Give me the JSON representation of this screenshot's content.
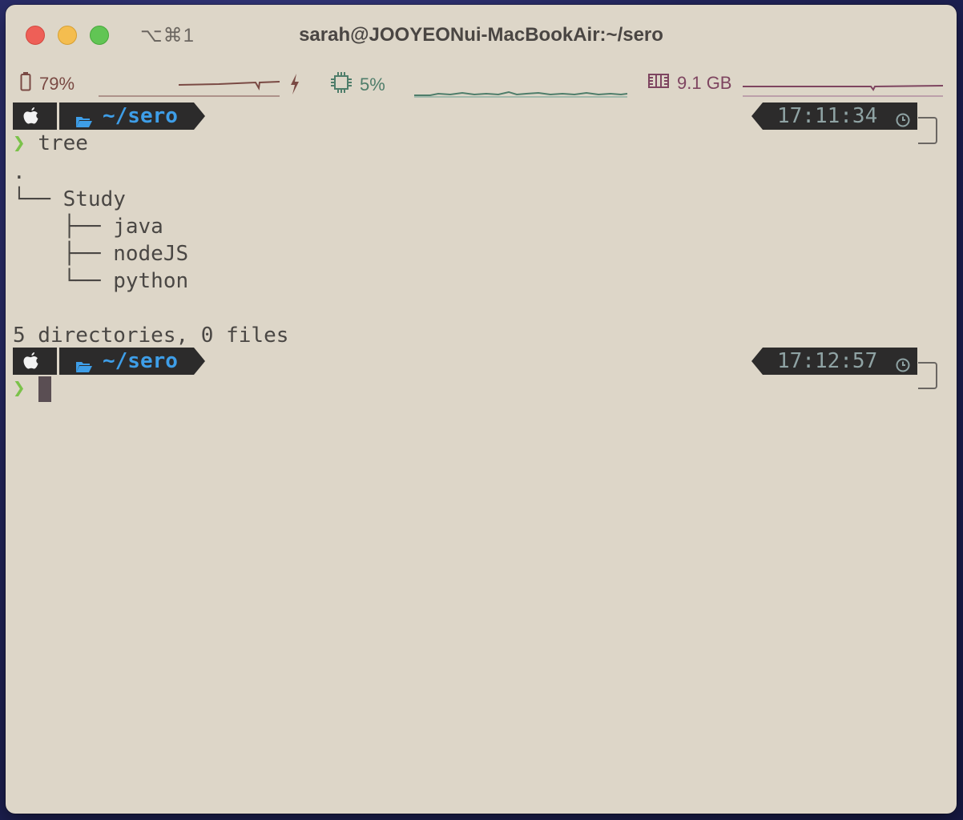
{
  "window": {
    "shortcut": "⌥⌘1",
    "title": "sarah@JOOYEONui-MacBookAir:~/sero"
  },
  "status_bar": {
    "battery": {
      "value": "79%",
      "icon": "battery-icon",
      "charging_icon": "lightning-icon"
    },
    "cpu": {
      "value": "5%",
      "icon": "cpu-chip-icon"
    },
    "memory": {
      "value": "9.1 GB",
      "icon": "memory-icon"
    }
  },
  "colors": {
    "background": "#ddd6c8",
    "segment": "#2c2b2b",
    "path": "#3e9ee8",
    "prompt_chevron": "#7bc24a",
    "battery": "#7a4a44",
    "cpu": "#4e7d6a",
    "memory": "#7e4560"
  },
  "terminal": {
    "prompts": [
      {
        "os_icon": "apple-icon",
        "folder_icon": "folder-open-icon",
        "path": "~/sero",
        "time": "17:11:34",
        "clock_icon": "clock-icon"
      },
      {
        "os_icon": "apple-icon",
        "folder_icon": "folder-open-icon",
        "path": "~/sero",
        "time": "17:12:57",
        "clock_icon": "clock-icon"
      }
    ],
    "chevron": "❯",
    "command": "tree",
    "output": [
      ".",
      "└── Study",
      "    ├── java",
      "    ├── nodeJS",
      "    └── python",
      "",
      "5 directories, 0 files"
    ]
  }
}
